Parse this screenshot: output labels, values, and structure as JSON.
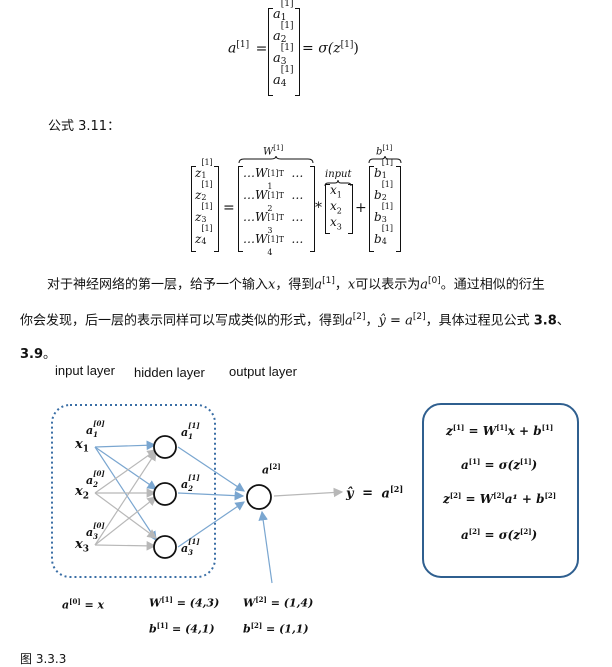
{
  "eq_top": {
    "lhs": "a",
    "lhs_sup": "[1]",
    "eq": "=",
    "rhs": "σ(z",
    "rhs_sup": "[1]",
    "rhs_close": ")",
    "entries": [
      {
        "base": "a",
        "sub": "1",
        "sup": "[1]"
      },
      {
        "base": "a",
        "sub": "2",
        "sup": "[1]"
      },
      {
        "base": "a",
        "sub": "3",
        "sup": "[1]"
      },
      {
        "base": "a",
        "sub": "4",
        "sup": "[1]"
      }
    ]
  },
  "formula_label": "公式 3.11：",
  "eq_mid": {
    "w_label": "W",
    "w_label_sup": "[1]",
    "b_label": "b",
    "b_label_sup": "[1]",
    "input_label": "input",
    "z_entries": [
      {
        "base": "z",
        "sub": "1",
        "sup": "[1]"
      },
      {
        "base": "z",
        "sub": "2",
        "sup": "[1]"
      },
      {
        "base": "z",
        "sub": "3",
        "sup": "[1]"
      },
      {
        "base": "z",
        "sub": "4",
        "sup": "[1]"
      }
    ],
    "w_rows": [
      {
        "pre": "…W",
        "sub": "1",
        "sup": "[1]T",
        "post": "…"
      },
      {
        "pre": "…W",
        "sub": "2",
        "sup": "[1]T",
        "post": "…"
      },
      {
        "pre": "…W",
        "sub": "3",
        "sup": "[1]T",
        "post": "…"
      },
      {
        "pre": "…W",
        "sub": "4",
        "sup": "[1]T",
        "post": "…"
      }
    ],
    "x_entries": [
      {
        "base": "x",
        "sub": "1"
      },
      {
        "base": "x",
        "sub": "2"
      },
      {
        "base": "x",
        "sub": "3"
      }
    ],
    "b_entries": [
      {
        "base": "b",
        "sub": "1",
        "sup": "[1]"
      },
      {
        "base": "b",
        "sub": "2",
        "sup": "[1]"
      },
      {
        "base": "b",
        "sub": "3",
        "sup": "[1]"
      },
      {
        "base": "b",
        "sub": "4",
        "sup": "[1]"
      }
    ],
    "eq": "=",
    "star": "*",
    "plus": "+"
  },
  "paragraph": {
    "line1_a": "对于神经网络的第一层，给予一个输入",
    "x1": "x",
    "line1_b": "，得到",
    "a1": "a",
    "a1_sup": "[1]",
    "line1_c": "，",
    "x2": "x",
    "line1_d": "可以表示为",
    "a0": "a",
    "a0_sup": "[0]",
    "line1_e": "。通过相似的衍生",
    "line2_a": "你会发现，后一层的表示同样可以写成类似的形式，得到",
    "a2": "a",
    "a2_sup": "[2]",
    "line2_b": "，",
    "yhat": "ŷ",
    "line2_eq": " = ",
    "a2b": "a",
    "a2b_sup": "[2]",
    "line2_c": "，具体过程见公式 ",
    "ref1": "3.8",
    "line2_d": "、",
    "ref2": "3.9",
    "line3_tail": "。"
  },
  "figure": {
    "layer_labels": [
      "input layer",
      "hidden layer",
      "output layer"
    ],
    "inputs": [
      {
        "x": "x",
        "x_sub": "1",
        "a": "a",
        "a_sub": "1",
        "a_sup": "[0]"
      },
      {
        "x": "x",
        "x_sub": "2",
        "a": "a",
        "a_sub": "2",
        "a_sup": "[0]"
      },
      {
        "x": "x",
        "x_sub": "3",
        "a": "a",
        "a_sub": "3",
        "a_sup": "[0]"
      }
    ],
    "hidden": [
      {
        "a": "a",
        "sub": "1",
        "sup": "[1]"
      },
      {
        "a": "a",
        "sub": "2",
        "sup": "[1]"
      },
      {
        "a": "a",
        "sub": "3",
        "sup": "[1]"
      }
    ],
    "output_label": {
      "a": "a",
      "sup": "[2]"
    },
    "yhat": "ŷ",
    "yhat_eq": "=",
    "yhat_a": "a",
    "yhat_sup": "[2]",
    "a0_eq_x": "a",
    "a0_eq_x_sup": "[0]",
    "a0_eq_x_rest": " = x",
    "W1": "W",
    "W1_sup": "[1]",
    "W1_val": " = (4,3)",
    "b1": "b",
    "b1_sup": "[1]",
    "b1_val": " = (4,1)",
    "W2": "W",
    "W2_sup": "[2]",
    "W2_val": " = (1,4)",
    "b2": "b",
    "b2_sup": "[2]",
    "b2_val": " = (1,1)",
    "box_eqs": [
      {
        "lhs": "z",
        "lhs_sup": "[1]",
        "rhs_a": " = W",
        "rhs_a_sup": "[1]",
        "rhs_b": "x + b",
        "rhs_b_sup": "[1]"
      },
      {
        "lhs": "a",
        "lhs_sup": "[1]",
        "rhs_a": " = σ(z",
        "rhs_a_sup": "[1]",
        "rhs_b": ")",
        "rhs_b_sup": ""
      },
      {
        "lhs": "z",
        "lhs_sup": "[2]",
        "rhs_a": " = W",
        "rhs_a_sup": "[2]",
        "rhs_b": "a¹ + b",
        "rhs_b_sup": "[2]"
      },
      {
        "lhs": "a",
        "lhs_sup": "[2]",
        "rhs_a": " = σ(z",
        "rhs_a_sup": "[2]",
        "rhs_b": ")",
        "rhs_b_sup": ""
      }
    ],
    "caption": "图 3.3.3"
  }
}
